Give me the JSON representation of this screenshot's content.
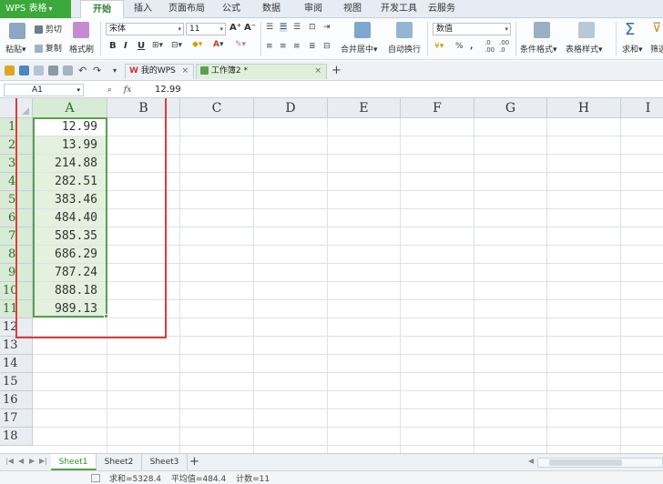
{
  "app": {
    "badge": "WPS 表格"
  },
  "menu": {
    "tabs": [
      "开始",
      "插入",
      "页面布局",
      "公式",
      "数据",
      "审阅",
      "视图",
      "开发工具",
      "云服务"
    ],
    "active_index": 0
  },
  "ribbon": {
    "paste": "粘贴",
    "cut": "剪切",
    "copy": "复制",
    "format_painter": "格式刷",
    "font_name": "宋体",
    "font_size": "11",
    "bold": "B",
    "italic": "I",
    "underline": "U",
    "grow_font": "A⁺",
    "shrink_font": "A⁻",
    "font_color_glyph": "A",
    "merge_center": "合并居中",
    "wrap_text": "自动换行",
    "number_format": "数值",
    "percent": "%",
    "comma": ",",
    "conditional_format": "条件格式",
    "table_style": "表格样式",
    "sum": "求和",
    "filter": "筛选"
  },
  "quickbar": {
    "tabs": [
      {
        "label": "我的WPS",
        "icon": "W"
      },
      {
        "label": "工作簿2 *",
        "icon": ""
      }
    ],
    "new_tab": "+"
  },
  "formula_bar": {
    "cell_ref": "A1",
    "fx": "fx",
    "value": "12.99"
  },
  "grid": {
    "columns": [
      "A",
      "B",
      "C",
      "D",
      "E",
      "F",
      "G",
      "H",
      "I"
    ],
    "rows": [
      "1",
      "2",
      "3",
      "4",
      "5",
      "6",
      "7",
      "8",
      "9",
      "10",
      "11",
      "12",
      "13",
      "14",
      "15",
      "16",
      "17",
      "18"
    ],
    "values": [
      "12.99",
      "13.99",
      "214.88",
      "282.51",
      "383.46",
      "484.40",
      "585.35",
      "686.29",
      "787.24",
      "888.18",
      "989.13"
    ]
  },
  "sheets": {
    "tabs": [
      "Sheet1",
      "Sheet2",
      "Sheet3"
    ],
    "active_index": 0,
    "add": "+"
  },
  "status": {
    "sum": "求和=5328.4",
    "average": "平均值=484.4",
    "count": "计数=11"
  },
  "colors": {
    "accent_green": "#5aa04f",
    "header_selected": "#d8ebd4",
    "cell_fill": "#e3f1de",
    "annotation_red": "#e03a3a",
    "app_badge": "#3aa83a"
  }
}
